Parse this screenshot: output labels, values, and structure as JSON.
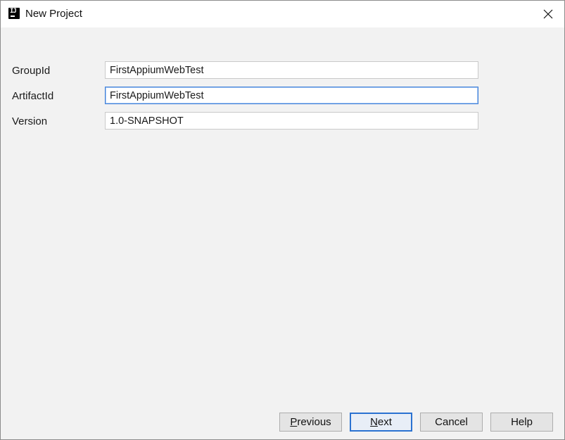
{
  "window": {
    "title": "New Project",
    "icon": "intellij-idea-icon",
    "close_icon": "close-icon"
  },
  "form": {
    "group_id": {
      "label": "GroupId",
      "value": "FirstAppiumWebTest"
    },
    "artifact_id": {
      "label": "ArtifactId",
      "value": "FirstAppiumWebTest",
      "focused": true
    },
    "version": {
      "label": "Version",
      "value": "1.0-SNAPSHOT"
    }
  },
  "buttons": {
    "previous": {
      "mnemonic": "P",
      "rest": "revious"
    },
    "next": {
      "mnemonic": "N",
      "rest": "ext"
    },
    "cancel": "Cancel",
    "help": "Help"
  },
  "colors": {
    "accent": "#3f7fd8",
    "background": "#f2f2f2",
    "titlebar": "#ffffff"
  }
}
